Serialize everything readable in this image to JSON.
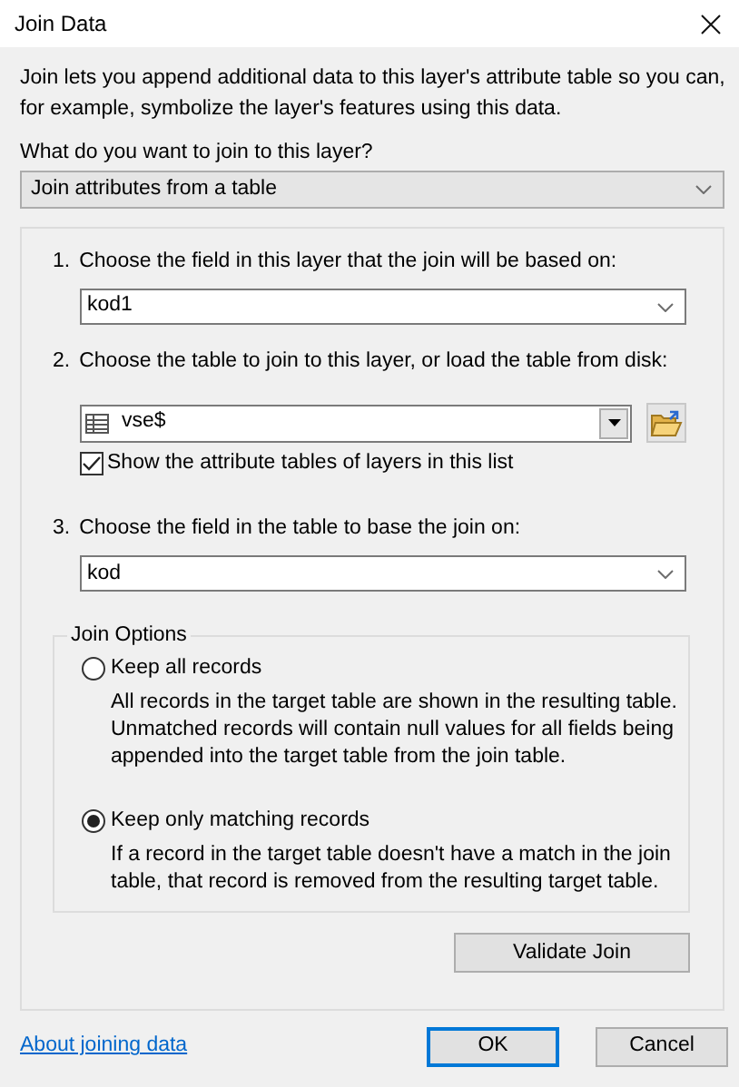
{
  "window": {
    "title": "Join Data"
  },
  "intro": "Join lets you append additional data to this layer's attribute table so you can, for example, symbolize the layer's features using this data.",
  "question": "What do you want to join to this layer?",
  "join_type": {
    "value": "Join attributes from a table"
  },
  "steps": [
    {
      "number": "1.",
      "label": "Choose the field in this layer that the join will be based on:",
      "kind": "dropdown",
      "value": "kod1"
    },
    {
      "number": "2.",
      "label": "Choose the table to join to this layer, or load the table from disk:",
      "kind": "table_picker",
      "value": "vse$",
      "checkbox": {
        "label": "Show the attribute tables of layers in this list",
        "checked": true
      }
    },
    {
      "number": "3.",
      "label": "Choose the field in the table to base the join on:",
      "kind": "dropdown",
      "value": "kod"
    }
  ],
  "join_options": {
    "title": "Join Options",
    "options": [
      {
        "label": "Keep all records",
        "description": "All records in the target table are shown in the resulting table. Unmatched records will contain null values for all fields being appended into the target table from the join table.",
        "selected": false
      },
      {
        "label": "Keep only matching records",
        "description": "If a record in the target table doesn't have a match in the join table, that record is removed from the resulting target table.",
        "selected": true
      }
    ]
  },
  "validate_button": "Validate Join",
  "help_link": "About joining data",
  "buttons": [
    {
      "label": "OK",
      "default": true
    },
    {
      "label": "Cancel",
      "default": false
    }
  ]
}
